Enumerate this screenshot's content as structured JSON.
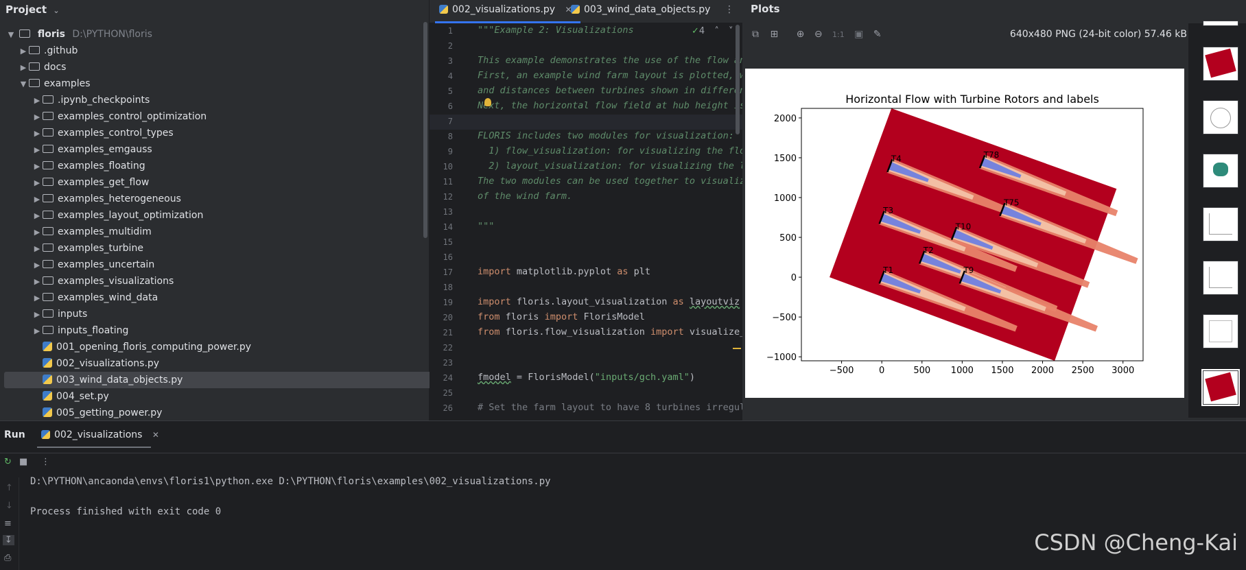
{
  "project": {
    "title": "Project",
    "root_name": "floris",
    "root_path": "D:\\PYTHON\\floris",
    "items": [
      {
        "label": ".github",
        "kind": "folder",
        "level": 1,
        "expanded": false
      },
      {
        "label": "docs",
        "kind": "folder",
        "level": 1,
        "expanded": false
      },
      {
        "label": "examples",
        "kind": "folder",
        "level": 1,
        "expanded": true
      },
      {
        "label": ".ipynb_checkpoints",
        "kind": "folder",
        "level": 2,
        "expanded": false
      },
      {
        "label": "examples_control_optimization",
        "kind": "folder",
        "level": 2,
        "expanded": false
      },
      {
        "label": "examples_control_types",
        "kind": "folder",
        "level": 2,
        "expanded": false
      },
      {
        "label": "examples_emgauss",
        "kind": "folder",
        "level": 2,
        "expanded": false
      },
      {
        "label": "examples_floating",
        "kind": "folder",
        "level": 2,
        "expanded": false
      },
      {
        "label": "examples_get_flow",
        "kind": "folder",
        "level": 2,
        "expanded": false
      },
      {
        "label": "examples_heterogeneous",
        "kind": "folder",
        "level": 2,
        "expanded": false
      },
      {
        "label": "examples_layout_optimization",
        "kind": "folder",
        "level": 2,
        "expanded": false
      },
      {
        "label": "examples_multidim",
        "kind": "folder",
        "level": 2,
        "expanded": false
      },
      {
        "label": "examples_turbine",
        "kind": "folder",
        "level": 2,
        "expanded": false
      },
      {
        "label": "examples_uncertain",
        "kind": "folder",
        "level": 2,
        "expanded": false
      },
      {
        "label": "examples_visualizations",
        "kind": "folder",
        "level": 2,
        "expanded": false
      },
      {
        "label": "examples_wind_data",
        "kind": "folder",
        "level": 2,
        "expanded": false
      },
      {
        "label": "inputs",
        "kind": "folder",
        "level": 2,
        "expanded": false
      },
      {
        "label": "inputs_floating",
        "kind": "folder",
        "level": 2,
        "expanded": false
      },
      {
        "label": "001_opening_floris_computing_power.py",
        "kind": "python",
        "level": 2
      },
      {
        "label": "002_visualizations.py",
        "kind": "python",
        "level": 2
      },
      {
        "label": "003_wind_data_objects.py",
        "kind": "python",
        "level": 2,
        "selected": true
      },
      {
        "label": "004_set.py",
        "kind": "python",
        "level": 2
      },
      {
        "label": "005_getting_power.py",
        "kind": "python",
        "level": 2
      }
    ]
  },
  "editor": {
    "tabs": [
      {
        "label": "002_visualizations.py",
        "active": true
      },
      {
        "label": "003_wind_data_objects.py",
        "active": false
      }
    ],
    "inspection_count": "4",
    "lines": [
      {
        "n": "1",
        "text": "\"\"\"Example 2: Visualizations",
        "cls": "doc"
      },
      {
        "n": "2",
        "text": "",
        "cls": "doc"
      },
      {
        "n": "3",
        "text": "This example demonstrates the use of the flow an",
        "cls": "doc"
      },
      {
        "n": "4",
        "text": "First, an example wind farm layout is plotted, w",
        "cls": "doc"
      },
      {
        "n": "5",
        "text": "and distances between turbines shown in differen",
        "cls": "doc"
      },
      {
        "n": "6",
        "text": "Next, the horizontal flow field at hub height is",
        "cls": "doc"
      },
      {
        "n": "7",
        "text": "",
        "cls": "doc"
      },
      {
        "n": "8",
        "text": "FLORIS includes two modules for visualization:",
        "cls": "doc"
      },
      {
        "n": "9",
        "text": "  1) flow_visualization: for visualizing the flo",
        "cls": "doc"
      },
      {
        "n": "10",
        "text": "  2) layout_visualization: for visualizing the l",
        "cls": "doc"
      },
      {
        "n": "11",
        "text": "The two modules can be used together to visualiz",
        "cls": "doc"
      },
      {
        "n": "12",
        "text": "of the wind farm.",
        "cls": "doc"
      },
      {
        "n": "13",
        "text": "",
        "cls": "doc"
      },
      {
        "n": "14",
        "text": "\"\"\"",
        "cls": "doc"
      },
      {
        "n": "15",
        "text": "",
        "cls": ""
      },
      {
        "n": "16",
        "text": "",
        "cls": ""
      },
      {
        "n": "17",
        "text": "import matplotlib.pyplot as plt",
        "cls": "code"
      },
      {
        "n": "18",
        "text": "",
        "cls": ""
      },
      {
        "n": "19",
        "text": "import floris.layout_visualization as layoutviz",
        "cls": "code"
      },
      {
        "n": "20",
        "text": "from floris import FlorisModel",
        "cls": "code"
      },
      {
        "n": "21",
        "text": "from floris.flow_visualization import visualize_",
        "cls": "code"
      },
      {
        "n": "22",
        "text": "",
        "cls": ""
      },
      {
        "n": "23",
        "text": "",
        "cls": ""
      },
      {
        "n": "24",
        "text": "fmodel = FlorisModel(\"inputs/gch.yaml\")",
        "cls": "code"
      },
      {
        "n": "25",
        "text": "",
        "cls": ""
      },
      {
        "n": "26",
        "text": "# Set the farm layout to have 8 turbines irregul",
        "cls": "cmt"
      }
    ]
  },
  "plots": {
    "title": "Plots",
    "image_info": "640x480 PNG (24-bit color) 57.46 kB",
    "zoom_label": "1:1"
  },
  "chart_data": {
    "type": "heatmap",
    "title": "Horizontal Flow with Turbine Rotors and labels",
    "xlabel": "",
    "ylabel": "",
    "xlim": [
      -1000,
      3250
    ],
    "ylim": [
      -1050,
      2120
    ],
    "xticks": [
      -500,
      0,
      500,
      1000,
      1500,
      2000,
      2500,
      3000
    ],
    "yticks": [
      -1000,
      -500,
      0,
      500,
      1000,
      1500,
      2000
    ],
    "domain_corners": [
      [
        -650,
        0
      ],
      [
        2150,
        -1050
      ],
      [
        2920,
        1110
      ],
      [
        120,
        2120
      ]
    ],
    "wake_direction_deg": -21,
    "turbines": [
      {
        "label": "T1",
        "x": 0,
        "y": 0
      },
      {
        "label": "T2",
        "x": 500,
        "y": 250
      },
      {
        "label": "T3",
        "x": 0,
        "y": 750
      },
      {
        "label": "T4",
        "x": 100,
        "y": 1400
      },
      {
        "label": "T9",
        "x": 1000,
        "y": 0
      },
      {
        "label": "T10",
        "x": 900,
        "y": 550
      },
      {
        "label": "T75",
        "x": 1500,
        "y": 850
      },
      {
        "label": "T78",
        "x": 1250,
        "y": 1450
      }
    ],
    "colors": {
      "background": "#b3001e",
      "wake_light": "#e8836a",
      "wake_mid": "#f3c3a8",
      "wake_core": "#6f7fe0"
    }
  },
  "run": {
    "title": "Run",
    "tab_label": "002_visualizations",
    "command": "D:\\PYTHON\\ancaonda\\envs\\floris1\\python.exe D:\\PYTHON\\floris\\examples\\002_visualizations.py",
    "exit_message": "Process finished with exit code 0"
  },
  "watermark": "CSDN @Cheng-Kai"
}
